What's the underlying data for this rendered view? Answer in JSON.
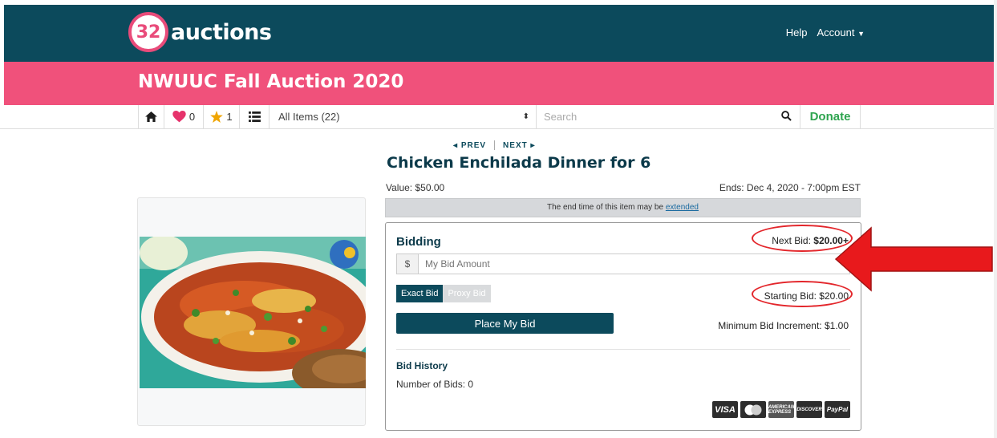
{
  "brand": {
    "logo_number": "32",
    "logo_text": "auctions"
  },
  "topnav": {
    "help": "Help",
    "account": "Account"
  },
  "auction": {
    "title": "NWUUC Fall Auction 2020"
  },
  "toolbar": {
    "favorites_count": "0",
    "starred_count": "1",
    "category_select": "All Items (22)",
    "search_placeholder": "Search",
    "donate": "Donate"
  },
  "pager": {
    "prev": "PREV",
    "next": "NEXT"
  },
  "item": {
    "title": "Chicken Enchilada Dinner for 6",
    "value": "Value: $50.00",
    "ends": "Ends: Dec 4, 2020 - 7:00pm EST",
    "notice_text": "The end time of this item may be",
    "notice_link": "extended"
  },
  "bidding": {
    "heading": "Bidding",
    "next_bid_label": "Next Bid:",
    "next_bid_value": "$20.00+",
    "currency_symbol": "$",
    "bid_placeholder": "My Bid Amount",
    "exact_bid": "Exact Bid",
    "proxy_bid": "Proxy Bid",
    "starting_bid": "Starting Bid: $20.00",
    "place_bid": "Place My Bid",
    "min_increment": "Minimum Bid Increment: $1.00"
  },
  "history": {
    "title": "Bid History",
    "count": "Number of Bids: 0"
  },
  "payment": {
    "visa": "VISA",
    "amex": "AMERICAN EXPRESS",
    "discover": "DISCOVER",
    "paypal": "PayPal"
  },
  "colors": {
    "primary": "#0c4a5c",
    "accent": "#f0517b",
    "donate": "#2ea44f",
    "annotation": "#e3262b"
  },
  "icons": [
    "home-icon",
    "heart-icon",
    "star-icon",
    "list-icon",
    "search-icon",
    "arrow-annotation"
  ]
}
